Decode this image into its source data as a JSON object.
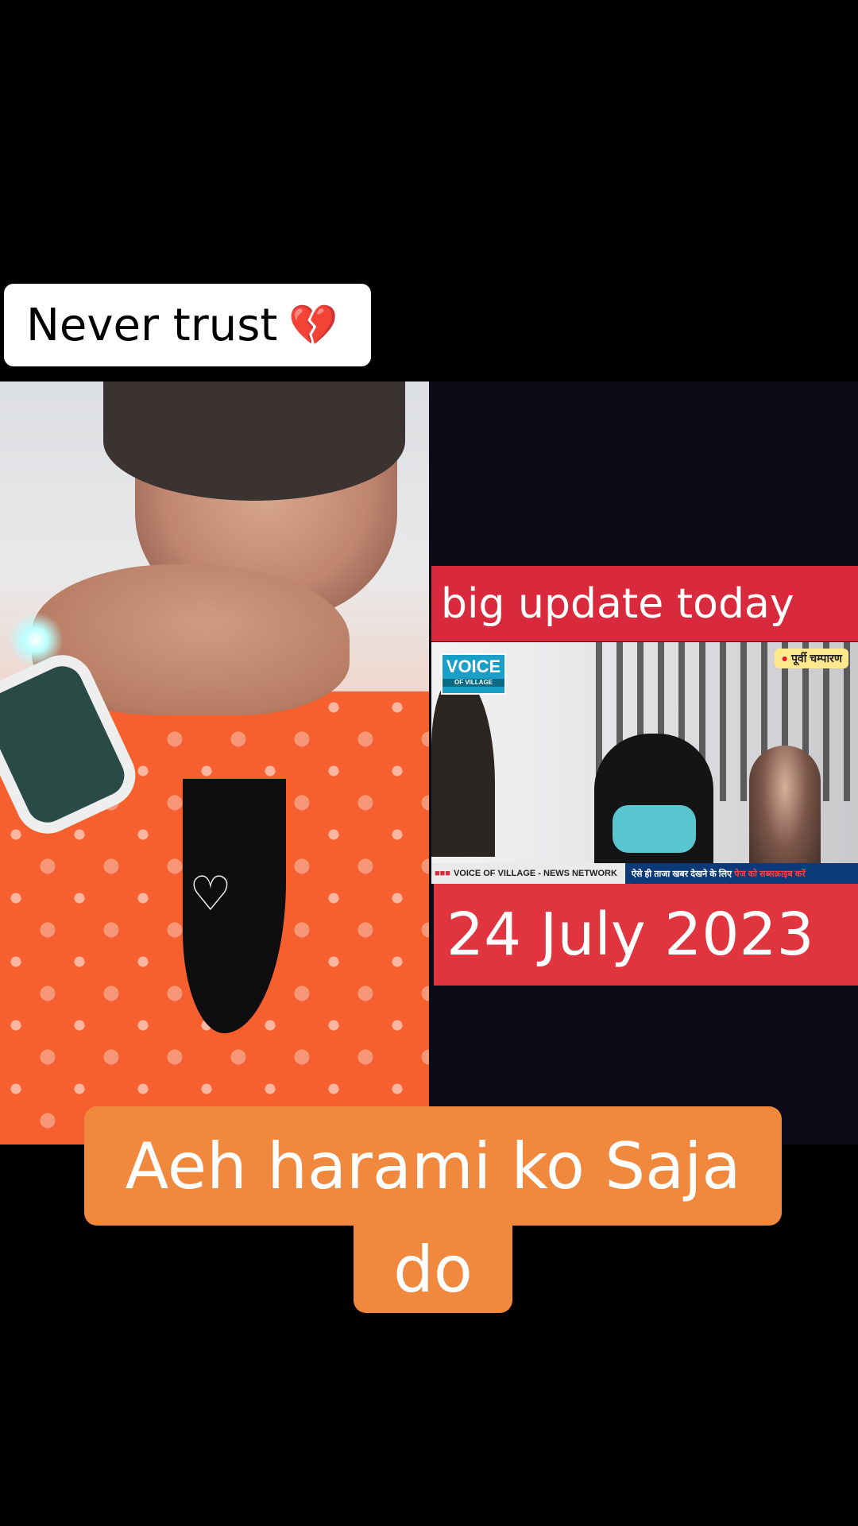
{
  "top_caption": {
    "text": "Never trust",
    "emoji": "💔"
  },
  "right_panel": {
    "headline": "big update today",
    "news_logo": {
      "main": "VOICE",
      "sub": "OF VILLAGE"
    },
    "location_tag": "पूर्वी चम्पारण",
    "ticker_network": "VOICE OF VILLAGE - NEWS NETWORK",
    "ticker_text": "ऐसे ही ताजा खबर देखने के लिए",
    "ticker_highlight": "पेज को सब्सक्राइब करें",
    "date": "24 July 2023"
  },
  "bottom_caption": {
    "line1": "Aeh harami ko Saja",
    "line2": "do"
  },
  "colors": {
    "headline_red": "#d92a3d",
    "caption_orange": "#f0883e",
    "background": "#000000"
  }
}
